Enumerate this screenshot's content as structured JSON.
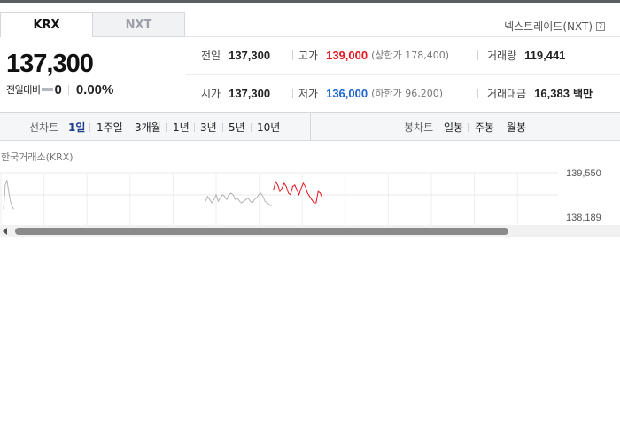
{
  "tabs": [
    {
      "label": "KRX",
      "active": true
    },
    {
      "label": "NXT",
      "active": false
    }
  ],
  "nxt_link": {
    "label": "넥스트레이드(NXT)",
    "icon": "help-icon"
  },
  "quote": {
    "price": "137,300",
    "change_label": "전일대비",
    "change_icon": "flat-icon",
    "change_value": "0",
    "change_pct": "0.00%"
  },
  "stats": {
    "prev_close": {
      "label": "전일",
      "value": "137,300"
    },
    "high": {
      "label": "고가",
      "value": "139,000",
      "limit_text": "(상한가 178,400)"
    },
    "volume": {
      "label": "거래량",
      "value": "119,441"
    },
    "open": {
      "label": "시가",
      "value": "137,300"
    },
    "low": {
      "label": "저가",
      "value": "136,000",
      "limit_text": "(하한가 96,200)"
    },
    "trade_value": {
      "label": "거래대금",
      "value": "16,383",
      "unit": "백만"
    }
  },
  "colors": {
    "up": "#e8151d",
    "down": "#1c63d3",
    "flat_line": "#b3b3b3",
    "accent": "#1d3d8f"
  },
  "toolbar": {
    "line_chart_label": "선차트",
    "periods": [
      "1일",
      "1주일",
      "3개월",
      "1년",
      "3년",
      "5년",
      "10년"
    ],
    "selected_period": "1일",
    "candle_chart_label": "봉차트",
    "candle_periods": [
      "일봉",
      "주봉",
      "월봉"
    ]
  },
  "chart": {
    "caption": "한국거래소(KRX)",
    "y_ticks": [
      "139,550",
      "138,189"
    ]
  },
  "chart_data": {
    "type": "line",
    "title": "",
    "xlabel": "",
    "ylabel": "",
    "y_ticks": [
      139550,
      138189
    ],
    "ylim": [
      136830,
      139550
    ],
    "grid": true,
    "series": [
      {
        "color": "#b3b3b3",
        "x": [
          0.0,
          0.4,
          0.8,
          1.2,
          1.6,
          2.0,
          2.4
        ],
        "values": [
          137300,
          138800,
          139100,
          138400,
          137800,
          137500,
          137300
        ]
      },
      {
        "color": "#b3b3b3",
        "x": [
          47.5,
          48.0,
          48.5,
          49.0,
          49.5,
          50.0,
          50.5,
          51.0,
          51.5,
          52.0,
          52.5,
          53.0,
          53.5,
          54.0,
          54.5,
          55.0,
          55.5,
          56.0,
          56.5,
          57.0,
          57.5,
          58.0,
          58.5,
          59.0,
          59.5,
          60.0,
          60.5,
          61.0,
          61.5,
          62.0,
          62.5,
          63.0
        ],
        "values": [
          137800,
          138100,
          137900,
          137700,
          137900,
          138200,
          137800,
          138000,
          138200,
          138100,
          137900,
          138200,
          138300,
          138200,
          137900,
          138000,
          137800,
          137700,
          137800,
          137900,
          138000,
          137800,
          137700,
          137900,
          138000,
          138200,
          138300,
          138100,
          137800,
          137700,
          137600,
          137500
        ]
      },
      {
        "color": "#e8151d",
        "x": [
          63.5,
          64.0,
          64.5,
          65.0,
          65.5,
          66.0,
          66.5,
          67.0,
          67.5,
          68.0,
          68.5,
          69.0,
          69.5,
          70.0,
          70.5,
          71.0,
          71.5,
          72.0,
          72.5,
          73.0,
          73.5,
          74.0,
          74.5,
          75.0
        ],
        "values": [
          138500,
          139000,
          138800,
          138400,
          138600,
          138900,
          138700,
          138300,
          138200,
          138700,
          138800,
          138500,
          138200,
          138600,
          138900,
          138700,
          138300,
          138100,
          137900,
          137700,
          137700,
          138400,
          138300,
          138000
        ]
      }
    ]
  }
}
